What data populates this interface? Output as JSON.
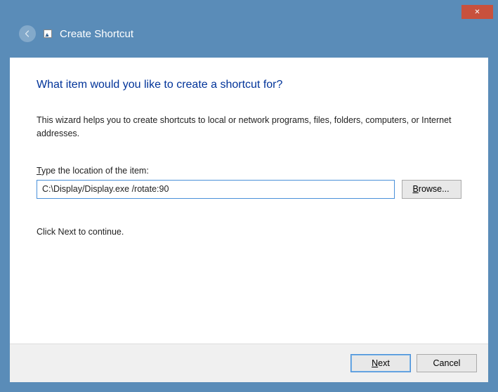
{
  "header": {
    "title": "Create Shortcut"
  },
  "main": {
    "heading": "What item would you like to create a shortcut for?",
    "description": "This wizard helps you to create shortcuts to local or network programs, files, folders, computers, or Internet addresses.",
    "input_label_prefix": "T",
    "input_label_rest": "ype the location of the item:",
    "location_value": "C:\\Display/Display.exe /rotate:90",
    "browse_prefix": "B",
    "browse_rest": "rowse...",
    "continue_text": "Click Next to continue."
  },
  "footer": {
    "next_prefix": "N",
    "next_rest": "ext",
    "cancel_label": "Cancel"
  }
}
